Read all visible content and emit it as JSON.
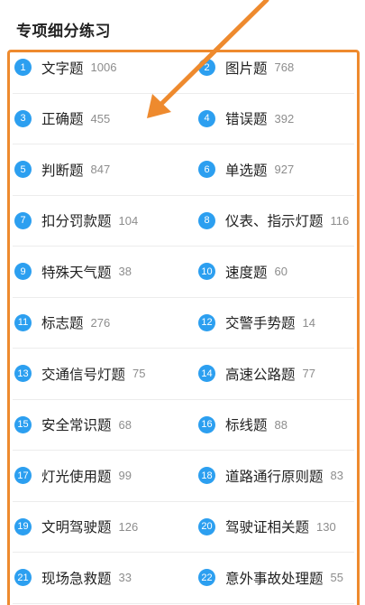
{
  "header": {
    "title": "专项细分练习"
  },
  "categories": [
    {
      "num": "1",
      "name": "文字题",
      "count": "1006"
    },
    {
      "num": "2",
      "name": "图片题",
      "count": "768"
    },
    {
      "num": "3",
      "name": "正确题",
      "count": "455"
    },
    {
      "num": "4",
      "name": "错误题",
      "count": "392"
    },
    {
      "num": "5",
      "name": "判断题",
      "count": "847"
    },
    {
      "num": "6",
      "name": "单选题",
      "count": "927"
    },
    {
      "num": "7",
      "name": "扣分罚款题",
      "count": "104"
    },
    {
      "num": "8",
      "name": "仪表、指示灯题",
      "count": "116"
    },
    {
      "num": "9",
      "name": "特殊天气题",
      "count": "38"
    },
    {
      "num": "10",
      "name": "速度题",
      "count": "60"
    },
    {
      "num": "11",
      "name": "标志题",
      "count": "276"
    },
    {
      "num": "12",
      "name": "交警手势题",
      "count": "14"
    },
    {
      "num": "13",
      "name": "交通信号灯题",
      "count": "75"
    },
    {
      "num": "14",
      "name": "高速公路题",
      "count": "77"
    },
    {
      "num": "15",
      "name": "安全常识题",
      "count": "68"
    },
    {
      "num": "16",
      "name": "标线题",
      "count": "88"
    },
    {
      "num": "17",
      "name": "灯光使用题",
      "count": "99"
    },
    {
      "num": "18",
      "name": "道路通行原则题",
      "count": "83"
    },
    {
      "num": "19",
      "name": "文明驾驶题",
      "count": "126"
    },
    {
      "num": "20",
      "name": "驾驶证相关题",
      "count": "130"
    },
    {
      "num": "21",
      "name": "现场急救题",
      "count": "33"
    },
    {
      "num": "22",
      "name": "意外事故处理题",
      "count": "55"
    }
  ],
  "colors": {
    "badge": "#2c9ff0",
    "annotation": "#ee8a2e"
  },
  "annotation": {
    "shapes": [
      "arrow",
      "box"
    ]
  }
}
